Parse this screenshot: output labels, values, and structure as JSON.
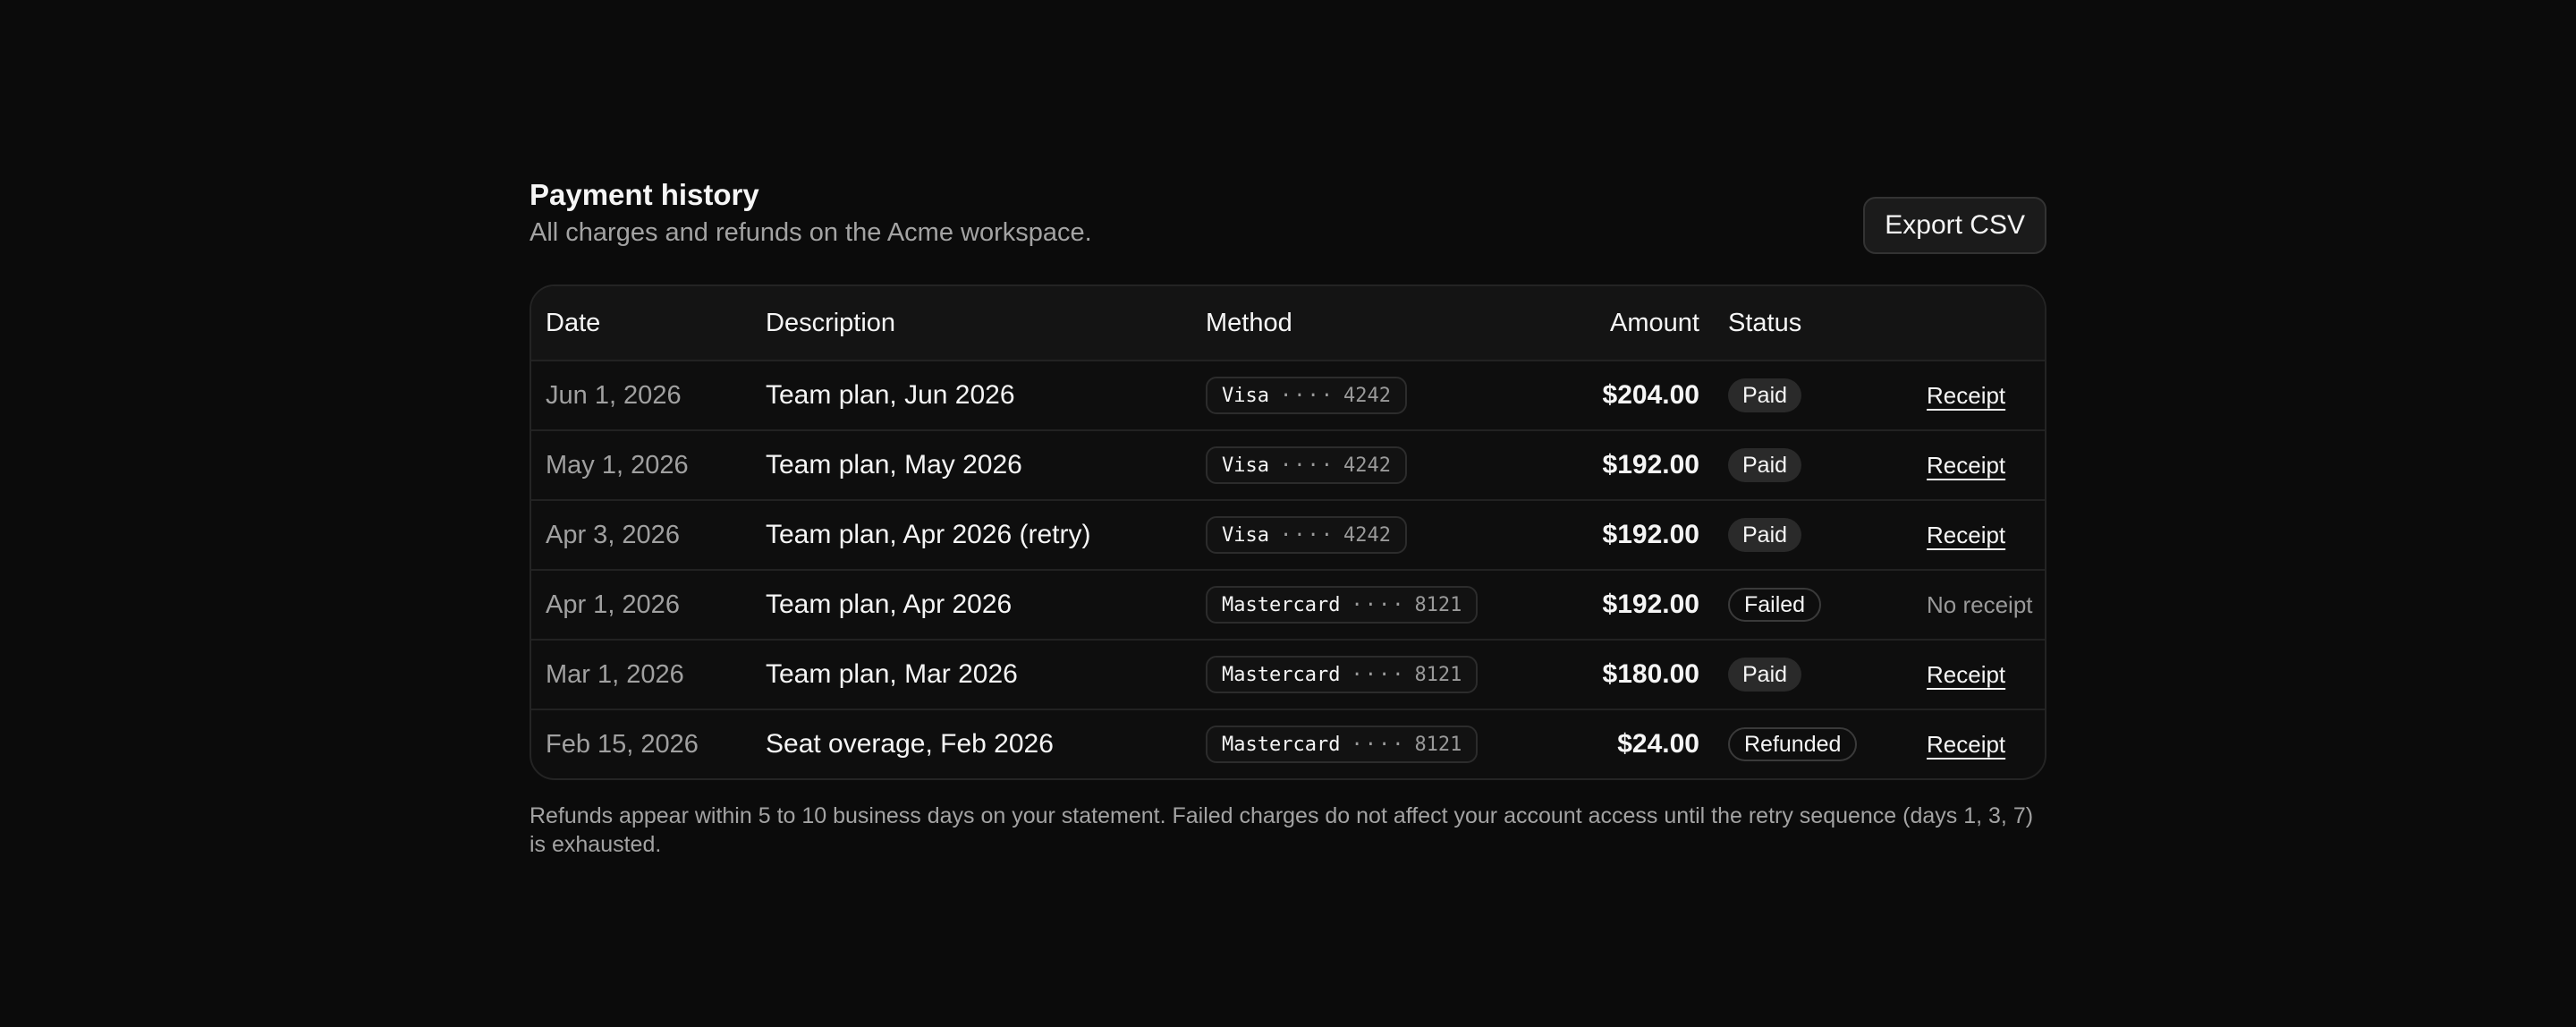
{
  "header": {
    "title": "Payment history",
    "subtitle": "All charges and refunds on the Acme workspace.",
    "export_label": "Export CSV"
  },
  "table": {
    "columns": {
      "date": "Date",
      "description": "Description",
      "method": "Method",
      "amount": "Amount",
      "status": "Status"
    },
    "rows": [
      {
        "date": "Jun 1, 2026",
        "description": "Team plan, Jun 2026",
        "method_brand": "Visa",
        "method_dots": "····",
        "method_last4": "4242",
        "amount": "$204.00",
        "status": "Paid",
        "status_style": "paid",
        "receipt": "Receipt",
        "has_receipt": true
      },
      {
        "date": "May 1, 2026",
        "description": "Team plan, May 2026",
        "method_brand": "Visa",
        "method_dots": "····",
        "method_last4": "4242",
        "amount": "$192.00",
        "status": "Paid",
        "status_style": "paid",
        "receipt": "Receipt",
        "has_receipt": true
      },
      {
        "date": "Apr 3, 2026",
        "description": "Team plan, Apr 2026 (retry)",
        "method_brand": "Visa",
        "method_dots": "····",
        "method_last4": "4242",
        "amount": "$192.00",
        "status": "Paid",
        "status_style": "paid",
        "receipt": "Receipt",
        "has_receipt": true
      },
      {
        "date": "Apr 1, 2026",
        "description": "Team plan, Apr 2026",
        "method_brand": "Mastercard",
        "method_dots": "····",
        "method_last4": "8121",
        "amount": "$192.00",
        "status": "Failed",
        "status_style": "outline",
        "receipt": "No receipt",
        "has_receipt": false
      },
      {
        "date": "Mar 1, 2026",
        "description": "Team plan, Mar 2026",
        "method_brand": "Mastercard",
        "method_dots": "····",
        "method_last4": "8121",
        "amount": "$180.00",
        "status": "Paid",
        "status_style": "paid",
        "receipt": "Receipt",
        "has_receipt": true
      },
      {
        "date": "Feb 15, 2026",
        "description": "Seat overage, Feb 2026",
        "method_brand": "Mastercard",
        "method_dots": "····",
        "method_last4": "8121",
        "amount": "$24.00",
        "status": "Refunded",
        "status_style": "outline",
        "receipt": "Receipt",
        "has_receipt": true
      }
    ]
  },
  "footnote": "Refunds appear within 5 to 10 business days on your statement. Failed charges do not affect your account access until the retry sequence (days 1, 3, 7) is exhausted.",
  "colors": {
    "background": "#0b0b0b",
    "text": "#f5f5f5",
    "muted": "#a3a3a3",
    "paid_badge": "#2a2a2a"
  }
}
